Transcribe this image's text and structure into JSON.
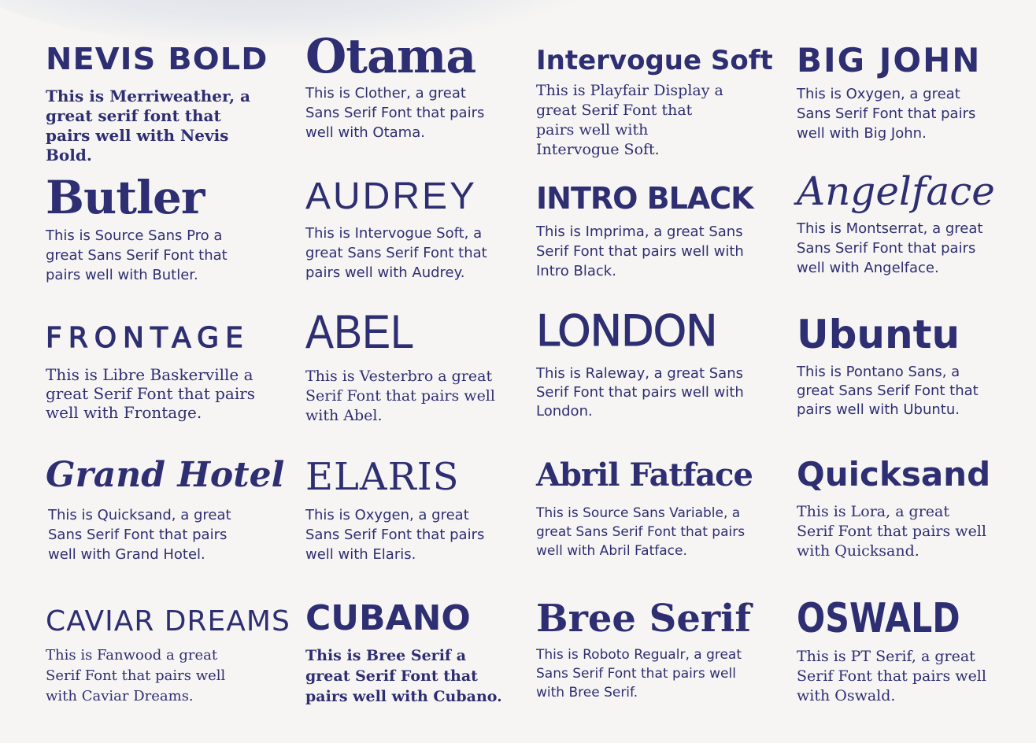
{
  "palette": {
    "ink": "#2e2e72",
    "background": "#f7f5f3"
  },
  "pairings": [
    [
      {
        "heading": "NEVIS BOLD",
        "description": "This is Merriweather, a great serif font that pairs well with Nevis Bold."
      },
      {
        "heading": "Otama",
        "description": "This is Clother, a great Sans Serif Font that pairs well with Otama."
      },
      {
        "heading": "Intervogue Soft",
        "description": "This is Playfair Display a great Serif Font that pairs well with Intervogue Soft."
      },
      {
        "heading": "BIG JOHN",
        "description": "This is Oxygen, a great Sans Serif Font that pairs well with Big John."
      }
    ],
    [
      {
        "heading": "Butler",
        "description": "This is Source Sans Pro a great Sans Serif Font that pairs well with Butler."
      },
      {
        "heading": "AUDREY",
        "description": "This is Intervogue Soft, a great Sans Serif Font that pairs well with Audrey."
      },
      {
        "heading": "INTRO BLACK",
        "description": "This is Imprima, a great Sans Serif Font that pairs well with Intro Black."
      },
      {
        "heading": "Angelface",
        "description": "This is Montserrat, a great Sans Serif Font that pairs well with Angelface."
      }
    ],
    [
      {
        "heading": "FRONTAGE",
        "description": "This is Libre Baskerville a great Serif Font that pairs well with Frontage."
      },
      {
        "heading": "ABEL",
        "description": "This is Vesterbro a great Serif Font that pairs well with Abel."
      },
      {
        "heading": "LONDON",
        "description": "This is Raleway, a great Sans Serif Font that pairs well with London."
      },
      {
        "heading": "Ubuntu",
        "description": "This is Pontano Sans, a great Sans Serif Font that pairs well with Ubuntu."
      }
    ],
    [
      {
        "heading": "Grand Hotel",
        "description": "This is Quicksand, a great Sans Serif Font that pairs well with Grand Hotel."
      },
      {
        "heading": "ELARIS",
        "description": "This is Oxygen, a great Sans Serif Font that pairs well with Elaris."
      },
      {
        "heading": "Abril Fatface",
        "description": "This is Source Sans Variable, a great Sans Serif Font that pairs well with Abril Fatface."
      },
      {
        "heading": "Quicksand",
        "description": "This is Lora, a great Serif Font that pairs well with Quicksand."
      }
    ],
    [
      {
        "heading": "CAVIAR DREAMS",
        "description": "This is Fanwood a great Serif Font that pairs well with Caviar Dreams."
      },
      {
        "heading": "CUBANO",
        "description": "This is Bree Serif a great Serif Font that pairs well with Cubano."
      },
      {
        "heading": "Bree Serif",
        "description": "This is Roboto Regualr, a great Sans Serif Font that pairs well with Bree Serif."
      },
      {
        "heading": "OSWALD",
        "description": "This is PT Serif, a great Serif Font that pairs well with Oswald."
      }
    ]
  ]
}
